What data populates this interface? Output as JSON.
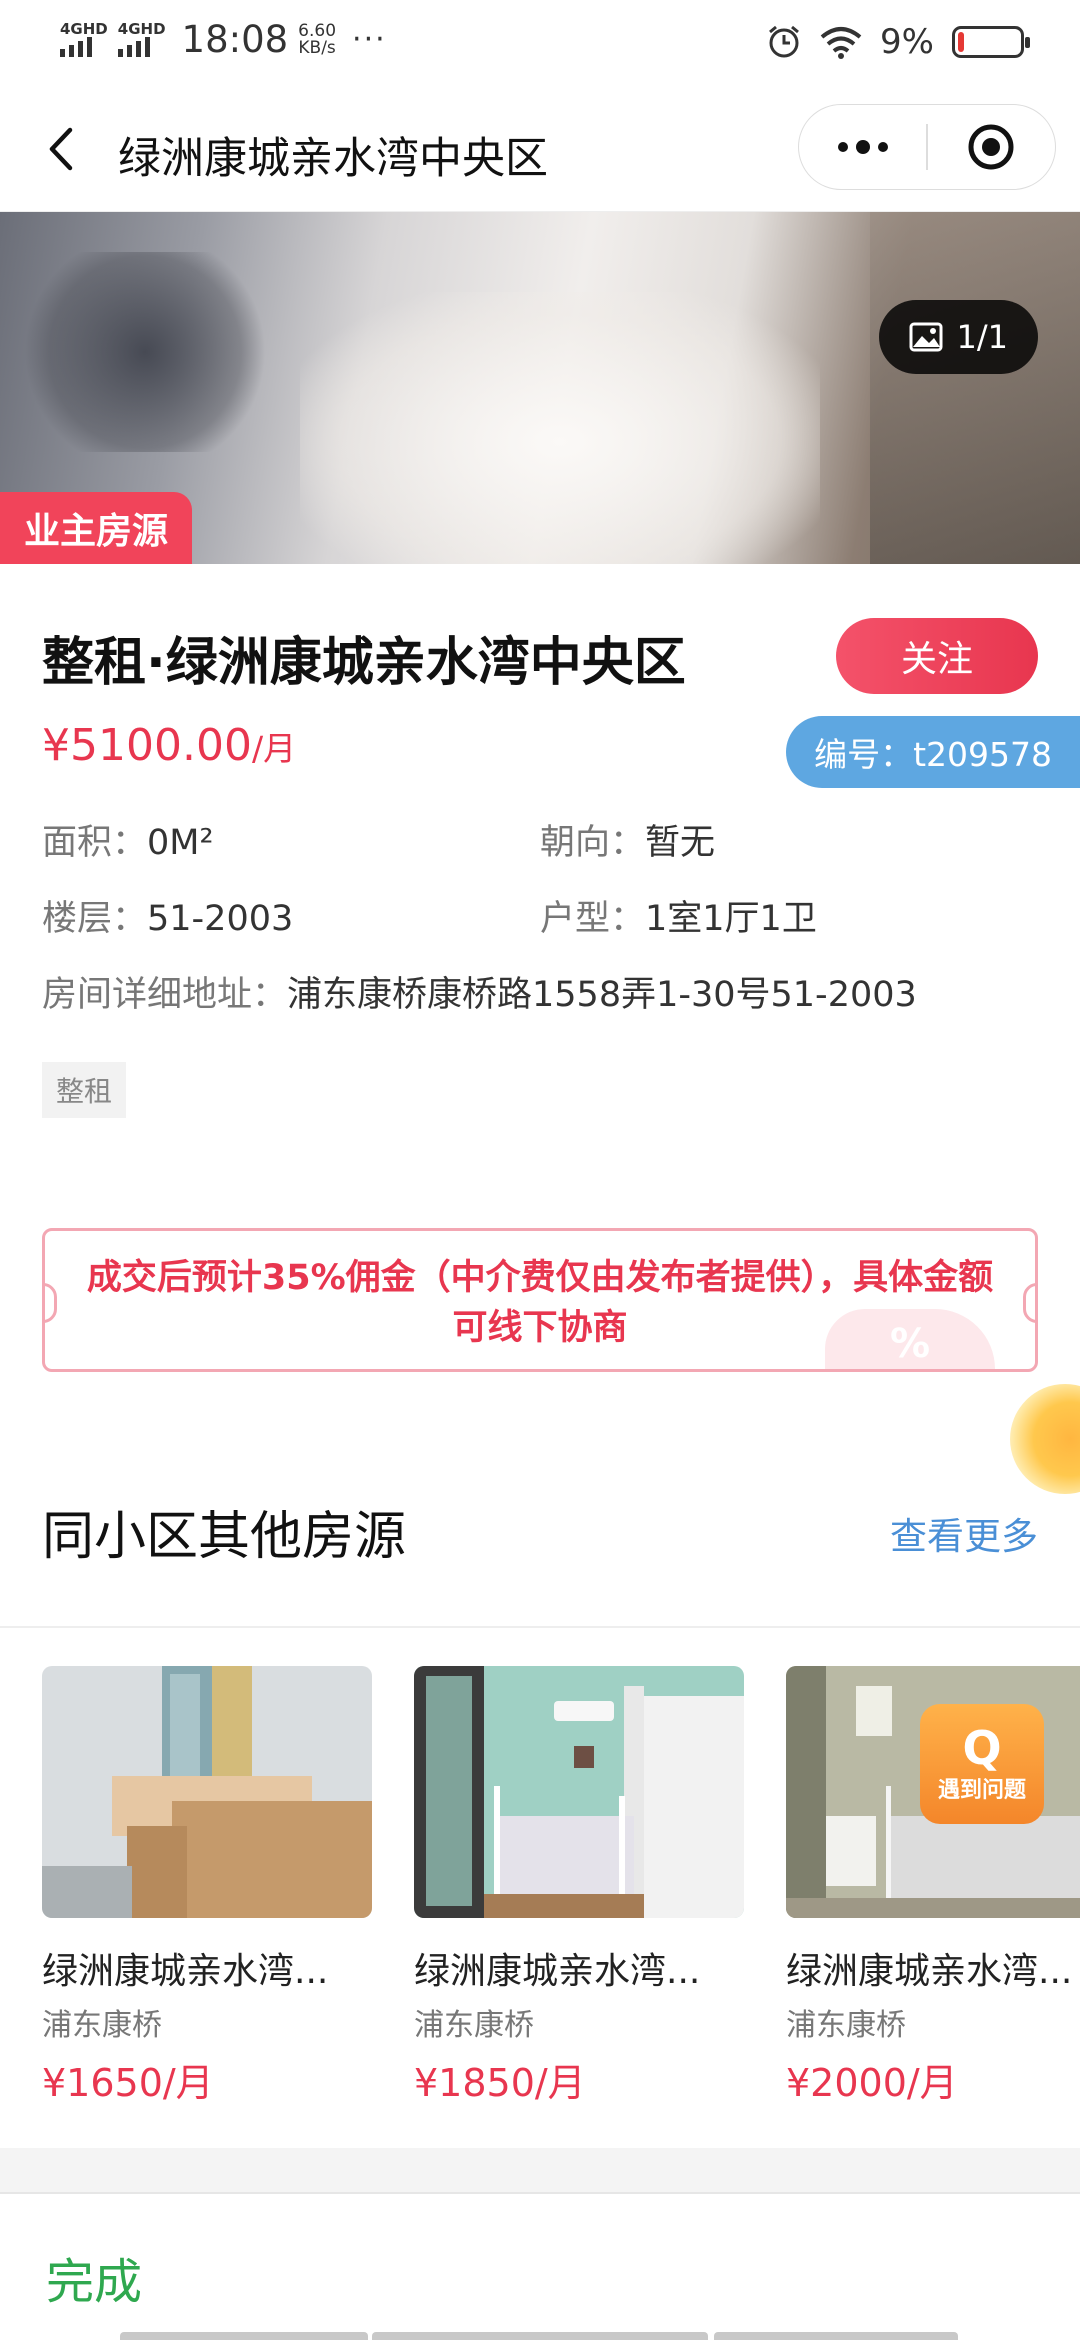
{
  "status_bar": {
    "signal1": "4GHD",
    "signal2": "4GHD",
    "time": "18:08",
    "speed_value": "6.60",
    "speed_unit": "KB/s",
    "more": "···",
    "battery_text": "9%",
    "battery_level": 0.09,
    "battery_color": "#e53935"
  },
  "nav": {
    "title": "绿洲康城亲水湾中央区",
    "back_icon": "chevron-left-icon",
    "more_icon": "more-dots-icon",
    "close_icon": "target-icon"
  },
  "hero": {
    "badge": "业主房源",
    "counter": "1/1",
    "counter_icon": "image-icon"
  },
  "listing": {
    "title": "整租·绿洲康城亲水湾中央区",
    "follow_label": "关注",
    "price": "¥5100.00",
    "price_unit": "/月",
    "code": "编号：t209578",
    "area_label": "面积：",
    "area_value": "0M²",
    "orientation_label": "朝向：",
    "orientation_value": "暂无",
    "floor_label": "楼层：",
    "floor_value": "51-2003",
    "layout_label": "户型：",
    "layout_value": "1室1厅1卫",
    "address_label": "房间详细地址：",
    "address_value": "浦东康桥康桥路1558弄1-30号51-2003",
    "tag": "整租"
  },
  "notice": {
    "text": "成交后预计35%佣金（中介费仅由发布者提供），具体金额可线下协商",
    "deco": "%"
  },
  "similar": {
    "section_title": "同小区其他房源",
    "see_more": "查看更多",
    "items": [
      {
        "name": "绿洲康城亲水湾...",
        "area": "浦东康桥",
        "price": "¥1650/月"
      },
      {
        "name": "绿洲康城亲水湾...",
        "area": "浦东康桥",
        "price": "¥1850/月"
      },
      {
        "name": "绿洲康城亲水湾...",
        "area": "浦东康桥",
        "price": "¥2000/月"
      }
    ]
  },
  "help": {
    "icon_letter": "Q",
    "label": "遇到问题"
  },
  "bottom": {
    "done_label": "完成"
  },
  "colors": {
    "accent_red": "#e8364f",
    "link_blue": "#4a8fd6",
    "done_green": "#2fa84f",
    "code_blue": "#5ea7e1"
  }
}
